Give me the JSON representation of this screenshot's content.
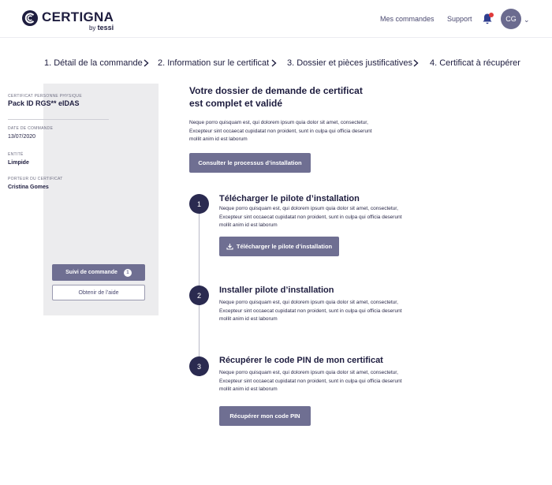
{
  "brand": {
    "name": "CERTIGNA",
    "by": "by",
    "by_brand": "tessi"
  },
  "nav": {
    "orders": "Mes commandes",
    "support": "Support",
    "avatar_initials": "CG"
  },
  "stepper": [
    {
      "label": "1. Détail de la commande"
    },
    {
      "label": "2. Information sur le certificat"
    },
    {
      "label": "3. Dossier et pièces justificatives"
    },
    {
      "label": "4. Certificat à récupérer"
    }
  ],
  "sidebar": {
    "cert_label": "CERTIFICAT PERSONNE PHYSIQUE",
    "cert_product": "Pack ID RGS** eIDAS",
    "date_label": "DATE DE COMMANDE",
    "date_value": "13/07/2020",
    "entity_label": "ENTITÉ",
    "entity_value": "Limpide",
    "holder_label": "PORTEUR DU CERTIFICAT",
    "holder_value": "Cristina Gomes",
    "track_button": "Suivi de commande",
    "track_badge": "1",
    "help_button": "Obtenir de l’aide"
  },
  "main": {
    "title_line1": "Votre dossier de demande de certificat",
    "title_line2": "est complet et validé",
    "paragraph": "Neque porro quisquam est, qui dolorem ipsum quia dolor sit amet, consectetur, Excepteur sint occaecat cupidatat non proident, sunt in culpa qui officia deserunt mollit anim id est laborum",
    "install_button": "Consulter le processus d’installation",
    "steps": [
      {
        "number": "1",
        "title": "Télécharger le pilote d’installation",
        "text": "Neque porro quisquam est, qui dolorem ipsum quia dolor sit amet, consectetur, Excepteur sint occaecat cupidatat non proident, sunt in culpa qui officia deserunt mollit anim id est laborum",
        "button": "Télécharger le pilote d’installation"
      },
      {
        "number": "2",
        "title": "Installer pilote d’installation",
        "text": "Neque porro quisquam est, qui dolorem ipsum quia dolor sit amet, consectetur, Excepteur sint occaecat cupidatat non proident, sunt in culpa qui officia deserunt mollit anim id est laborum"
      },
      {
        "number": "3",
        "title": "Récupérer le code PIN de mon certificat",
        "text": "Neque porro quisquam est, qui dolorem ipsum quia dolor sit amet, consectetur, Excepteur sint occaecat cupidatat non proident, sunt in culpa qui officia deserunt mollit anim id est laborum",
        "button": "Récupérer mon code PIN"
      }
    ]
  },
  "icons": {
    "logo": "certigna-logo-icon",
    "bell": "bell-icon",
    "chevron": "chevron-right-icon",
    "download": "download-icon"
  },
  "colors": {
    "primary": "#1e1d3f",
    "button": "#6f6f92",
    "notification": "#e03a3a",
    "sidebar_bg": "#ececee"
  }
}
